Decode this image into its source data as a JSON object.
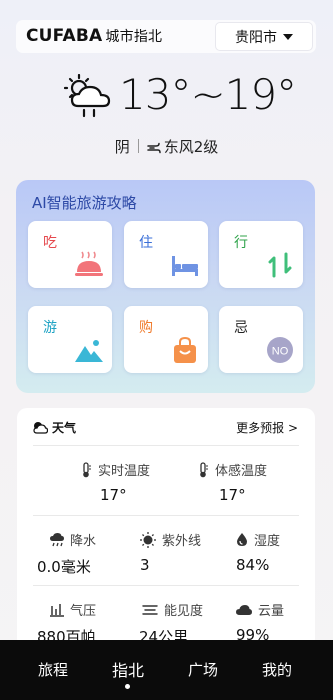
{
  "header": {
    "brand": "CUFABA",
    "subtitle": "城市指北",
    "city": "贵阳市"
  },
  "weather": {
    "icon": "cloud-rain-icon",
    "temp_range": "13°~19°",
    "condition": "阴",
    "wind": "东风2级"
  },
  "ai_guide": {
    "title": "AI智能旅游攻略",
    "tiles": [
      {
        "label": "吃",
        "color": "#e5484d",
        "icon": "food-cloche-icon"
      },
      {
        "label": "住",
        "color": "#3a6fd8",
        "icon": "bed-icon"
      },
      {
        "label": "行",
        "color": "#2fa34a",
        "icon": "swap-arrows-icon"
      },
      {
        "label": "游",
        "color": "#1fa3c4",
        "icon": "mountain-icon"
      },
      {
        "label": "购",
        "color": "#f07b2c",
        "icon": "shopping-bag-icon"
      },
      {
        "label": "忌",
        "color": "#222222",
        "icon": "no-icon",
        "icon_text": "NO"
      }
    ]
  },
  "weather_detail": {
    "title": "天气",
    "more": "更多预报 >",
    "realtime_label": "实时温度",
    "realtime_value": "17°",
    "feel_label": "体感温度",
    "feel_value": "17°",
    "rain_label": "降水",
    "rain_value": "0.0毫米",
    "uv_label": "紫外线",
    "uv_value": "3",
    "humidity_label": "湿度",
    "humidity_value": "84%",
    "pressure_label": "气压",
    "pressure_value": "880百帕",
    "visibility_label": "能见度",
    "visibility_value": "24公里",
    "cloud_label": "云量",
    "cloud_value": "99%"
  },
  "nav": {
    "items": [
      "旅程",
      "指北",
      "广场",
      "我的"
    ],
    "active": "指北"
  }
}
